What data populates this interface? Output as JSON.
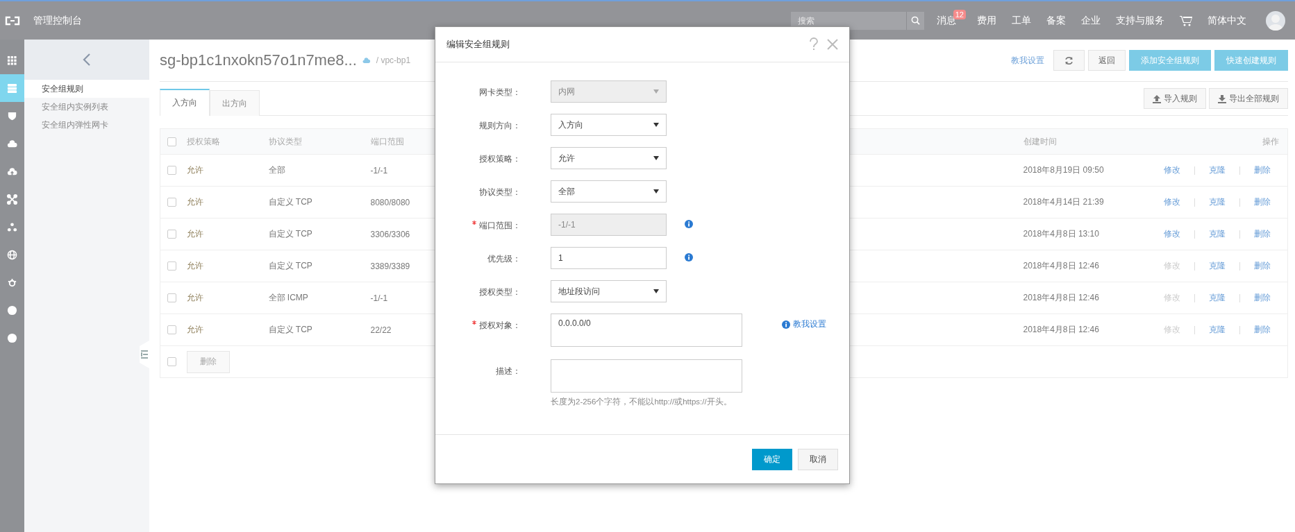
{
  "topbar": {
    "title": "管理控制台",
    "search": {
      "placeholder": "搜索"
    },
    "nav": [
      {
        "label": "消息",
        "badge": "12"
      },
      {
        "label": "费用"
      },
      {
        "label": "工单"
      },
      {
        "label": "备案"
      },
      {
        "label": "企业"
      },
      {
        "label": "支持与服务"
      }
    ],
    "language": "简体中文"
  },
  "rail": [
    {
      "kind": "grid",
      "selected": false
    },
    {
      "kind": "server",
      "selected": true
    },
    {
      "kind": "shield",
      "selected": false
    },
    {
      "kind": "cloud",
      "selected": false
    },
    {
      "kind": "cloud-upload",
      "selected": false
    },
    {
      "kind": "network",
      "selected": false
    },
    {
      "kind": "nodes",
      "selected": false
    },
    {
      "kind": "globe",
      "selected": false
    },
    {
      "kind": "gear",
      "selected": false
    },
    {
      "kind": "circle",
      "selected": false
    },
    {
      "kind": "circle",
      "selected": false
    }
  ],
  "sidebar": {
    "items": [
      {
        "label": "安全组规则",
        "selected": true
      },
      {
        "label": "安全组内实例列表",
        "selected": false
      },
      {
        "label": "安全组内弹性网卡",
        "selected": false
      }
    ]
  },
  "main": {
    "title": "sg-bp1c1nxokn57o1n7me8...",
    "breadcrumb": "/ vpc-bp1",
    "help_link": "教我设置",
    "buttons": [
      {
        "kind": "refresh"
      },
      {
        "kind": "plain",
        "label": "返回"
      },
      {
        "kind": "primary",
        "label": "添加安全组规则"
      },
      {
        "kind": "primary",
        "label": "快速创建规则"
      }
    ],
    "tabs": [
      {
        "label": "入方向",
        "selected": true
      },
      {
        "label": "出方向",
        "selected": false
      }
    ],
    "tools": [
      {
        "kind": "upload",
        "label": "导入规则"
      },
      {
        "kind": "download",
        "label": "导出全部规则"
      }
    ],
    "table": {
      "columns": [
        "授权策略",
        "协议类型",
        "端口范围",
        "创建时间",
        "操作"
      ],
      "rows": [
        {
          "checked": false,
          "policy": "允许",
          "protocol": "全部",
          "port": "-1/-1",
          "created": "2018年8月19日 09:50",
          "actions": [
            {
              "label": "修改",
              "disabled": false
            },
            {
              "label": "克隆",
              "disabled": false
            },
            {
              "label": "删除",
              "disabled": false
            }
          ]
        },
        {
          "checked": false,
          "policy": "允许",
          "protocol": "自定义 TCP",
          "port": "8080/8080",
          "created": "2018年4月14日 21:39",
          "actions": [
            {
              "label": "修改",
              "disabled": false
            },
            {
              "label": "克隆",
              "disabled": false
            },
            {
              "label": "删除",
              "disabled": false
            }
          ]
        },
        {
          "checked": false,
          "policy": "允许",
          "protocol": "自定义 TCP",
          "port": "3306/3306",
          "created": "2018年4月8日 13:10",
          "actions": [
            {
              "label": "修改",
              "disabled": false
            },
            {
              "label": "克隆",
              "disabled": false
            },
            {
              "label": "删除",
              "disabled": false
            }
          ]
        },
        {
          "checked": false,
          "policy": "允许",
          "protocol": "自定义 TCP",
          "port": "3389/3389",
          "created": "2018年4月8日 12:46",
          "actions": [
            {
              "label": "修改",
              "disabled": true
            },
            {
              "label": "克隆",
              "disabled": false
            },
            {
              "label": "删除",
              "disabled": false
            }
          ]
        },
        {
          "checked": false,
          "policy": "允许",
          "protocol": "全部 ICMP",
          "port": "-1/-1",
          "created": "2018年4月8日 12:46",
          "actions": [
            {
              "label": "修改",
              "disabled": true
            },
            {
              "label": "克隆",
              "disabled": false
            },
            {
              "label": "删除",
              "disabled": false
            }
          ]
        },
        {
          "checked": false,
          "policy": "允许",
          "protocol": "自定义 TCP",
          "port": "22/22",
          "created": "2018年4月8日 12:46",
          "actions": [
            {
              "label": "修改",
              "disabled": true
            },
            {
              "label": "克隆",
              "disabled": false
            },
            {
              "label": "删除",
              "disabled": false
            }
          ]
        }
      ],
      "select_all": false,
      "bulk_delete": {
        "label": "删除",
        "disabled": true
      }
    }
  },
  "dialog": {
    "title": "编辑安全组规则",
    "fields": [
      {
        "kind": "select",
        "label": "网卡类型：",
        "value": "内网",
        "disabled": true
      },
      {
        "kind": "select",
        "label": "规则方向：",
        "value": "入方向",
        "disabled": false
      },
      {
        "kind": "select",
        "label": "授权策略：",
        "value": "允许",
        "disabled": false
      },
      {
        "kind": "select",
        "label": "协议类型：",
        "value": "全部",
        "disabled": false
      },
      {
        "kind": "input",
        "label": "端口范围：",
        "value": "-1/-1",
        "disabled": true,
        "required": true,
        "info": true
      },
      {
        "kind": "input",
        "label": "优先级：",
        "value": "1",
        "disabled": false,
        "info": true
      },
      {
        "kind": "select",
        "label": "授权类型：",
        "value": "地址段访问",
        "disabled": false
      },
      {
        "kind": "textarea",
        "label": "授权对象：",
        "value": "0.0.0.0/0",
        "disabled": false,
        "required": true,
        "link": "教我设置"
      },
      {
        "kind": "textarea",
        "label": "描述：",
        "disabled": false,
        "hint": "长度为2-256个字符，不能以http://或https://开头。"
      }
    ],
    "buttons": [
      {
        "kind": "primary",
        "label": "确定"
      },
      {
        "kind": "plain",
        "label": "取消"
      }
    ]
  }
}
